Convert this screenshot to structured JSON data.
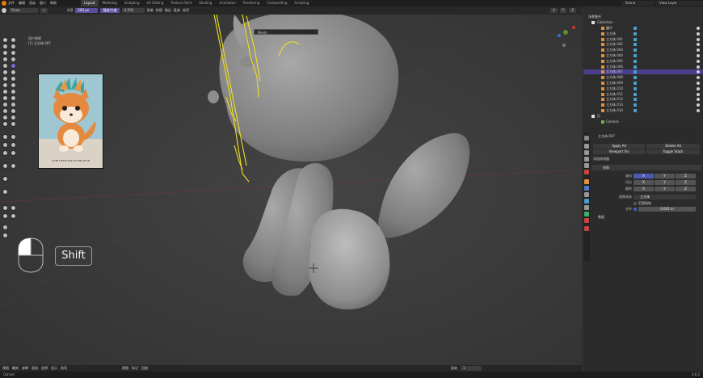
{
  "menu": [
    "文件",
    "编辑",
    "渲染",
    "窗口",
    "帮助"
  ],
  "workspaces": [
    "Layout",
    "Modeling",
    "Sculpting",
    "UV Editing",
    "Texture Paint",
    "Shading",
    "Animation",
    "Rendering",
    "Compositing",
    "Scripting"
  ],
  "scene_name": "Scene",
  "view_layer": "View Layer",
  "header": {
    "brush_name": "Draw",
    "radius_label": "半径",
    "radius_value": "200 px",
    "strength_label": "强度/力度",
    "strength_value": "0.500",
    "menus": [
      "画笔",
      "纹理",
      "描边",
      "衰减",
      "选项"
    ],
    "right_chips": [
      "X",
      "Y",
      "Z"
    ]
  },
  "viewport": {
    "mode_label": "用户透视",
    "object_label": "(1) 立方体.007",
    "search_text": "Meshi",
    "shift_key": "Shift",
    "reference_caption": "CUTE LITTLE FOX IN THE STYLE"
  },
  "bottom_bar": {
    "items": [
      "视图",
      "雕刻",
      "遮罩",
      "面组",
      "选择",
      "显示",
      "选项"
    ],
    "mid_items": [
      "视图",
      "标记",
      "回放"
    ],
    "frame_label": "起始",
    "frame_value": "1"
  },
  "status": {
    "left": "Cancel",
    "right": "3.6.2"
  },
  "outliner": {
    "title": "场景集合",
    "collection": "Collection",
    "items": [
      {
        "name": "圆环"
      },
      {
        "name": "立方体"
      },
      {
        "name": "立方体.001"
      },
      {
        "name": "立方体.002"
      },
      {
        "name": "立方体.003"
      },
      {
        "name": "立方体.004"
      },
      {
        "name": "立方体.005"
      },
      {
        "name": "立方体.006"
      },
      {
        "name": "立方体.007",
        "selected": true
      },
      {
        "name": "立方体.008"
      },
      {
        "name": "立方体.009"
      },
      {
        "name": "立方体.010"
      },
      {
        "name": "立方体.011"
      },
      {
        "name": "立方体.012"
      },
      {
        "name": "立方体.013"
      },
      {
        "name": "立方体.014"
      }
    ],
    "sub_collection": "灯",
    "camera": "Camera"
  },
  "properties": {
    "object_name": "立方体.007",
    "apply_all": "Apply All",
    "delete_all": "Delete All",
    "viewport_vis": "Viewport Vis",
    "toggle_stack": "Toggle Stack",
    "add_modifier": "添加修改器",
    "modifier_name": "镜像",
    "axis_label": "轴向",
    "bisect_label": "切分",
    "flip_label": "翻转",
    "axes": [
      "X",
      "Y",
      "Z"
    ],
    "mirror_object_label": "镜像物体",
    "mirror_object_value": "立方体",
    "clipping_label": "范围限制",
    "merge_label": "合并",
    "merge_value": "0.001 m",
    "data_label": "数据"
  },
  "colors": {
    "accent": "#5b4f9b",
    "selection": "#4a3f8c",
    "annotation": "#f0e020",
    "mesh": "#8c8c8c"
  }
}
